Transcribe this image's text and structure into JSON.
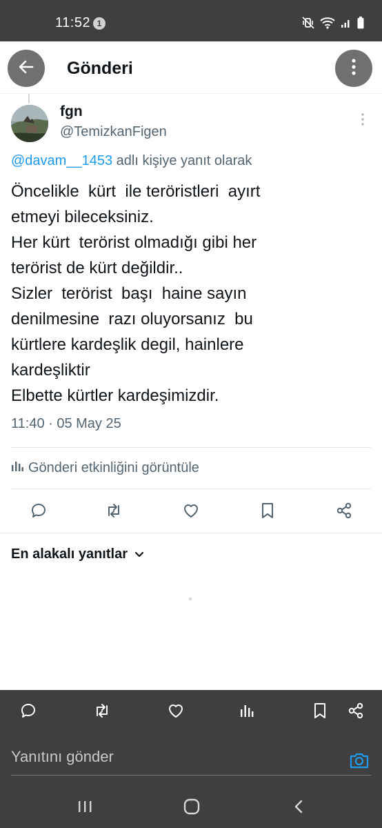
{
  "status_bar": {
    "time": "11:52",
    "notification_count": "1",
    "icons": [
      "mute-vibrate-icon",
      "wifi-icon",
      "signal-icon",
      "battery-icon"
    ]
  },
  "header": {
    "title": "Gönderi",
    "back_icon": "arrow-left-icon",
    "more_icon": "more-vertical-icon"
  },
  "tweet": {
    "author_name": "fgn",
    "author_handle": "@TemizkanFigen",
    "reply_mention": "@davam__1453",
    "reply_suffix": " adlı kişiye yanıt olarak",
    "text": "Öncelikle  kürt  ile teröristleri  ayırt\netmeyi bileceksiniz.\nHer kürt  terörist olmadığı gibi her\nterörist de kürt değildir..\nSizler  terörist  başı  haine sayın\ndenilmesine  razı oluyorsanız  bu\nkürtlere kardeşlik degil, hainlere\nkardeşliktir\nElbette kürtler kardeşimizdir.",
    "timestamp": "11:40 · 05 May 25",
    "activity_label": "Gönderi etkinliğini görüntüle"
  },
  "actions": [
    "reply-icon",
    "retweet-icon",
    "like-icon",
    "bookmark-icon",
    "share-icon"
  ],
  "replies": {
    "sort_label": "En alakalı yanıtlar"
  },
  "bottom_bar": {
    "actions": [
      "reply-icon",
      "retweet-icon",
      "like-icon",
      "views-icon",
      "bookmark-icon",
      "share-icon"
    ],
    "compose_placeholder": "Yanıtını gönder"
  },
  "colors": {
    "accent": "#1d9bf0",
    "text": "#0f1419",
    "secondary": "#536471",
    "status_bar": "#3f3f3f",
    "overlay": "#3f3f3f"
  }
}
